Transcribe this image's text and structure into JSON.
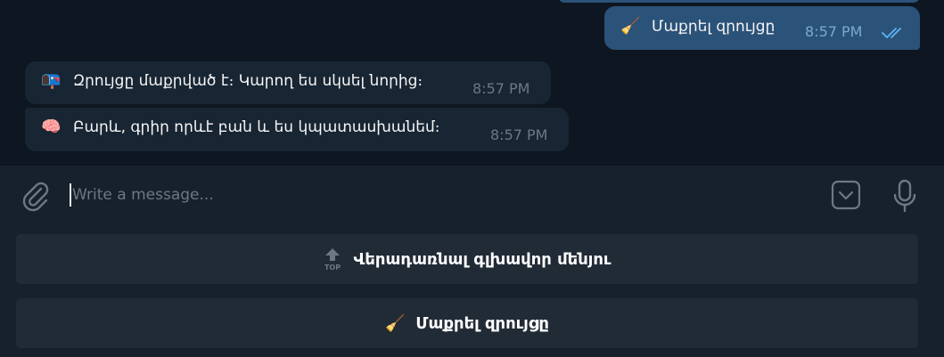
{
  "messages": {
    "outgoing": {
      "emoji": "🧹",
      "text": "Մաքրել զրույցը",
      "time": "8:57 PM",
      "status_icon": "double-check-icon"
    },
    "incoming": [
      {
        "emoji": "📭",
        "text": "Զրույցը մաքրված է։ Կարող ես սկսել նորից։",
        "time": "8:57 PM"
      },
      {
        "emoji": "🧠",
        "text": "Բարև, գրիր որևէ բան և ես կպատասխանեմ։",
        "time": "8:57 PM"
      }
    ]
  },
  "composer": {
    "placeholder": "Write a message...",
    "value": "",
    "icons": {
      "attach": "paperclip-icon",
      "keyboard": "keyboard-toggle-icon",
      "voice": "microphone-icon"
    }
  },
  "keyboard": {
    "buttons": [
      {
        "emoji": "🔝",
        "label": "Վերադառնալ գլխավոր մենյու"
      },
      {
        "emoji": "🧹",
        "label": "Մաքրել զրույցը"
      }
    ]
  },
  "colors": {
    "chat_bg": "#0e1621",
    "panel_bg": "#17212b",
    "outgoing_bubble": "#2b5278",
    "incoming_bubble": "#182533",
    "keyboard_button": "#202b36",
    "muted_text": "#6c7883",
    "check_color": "#5eb5f7"
  }
}
